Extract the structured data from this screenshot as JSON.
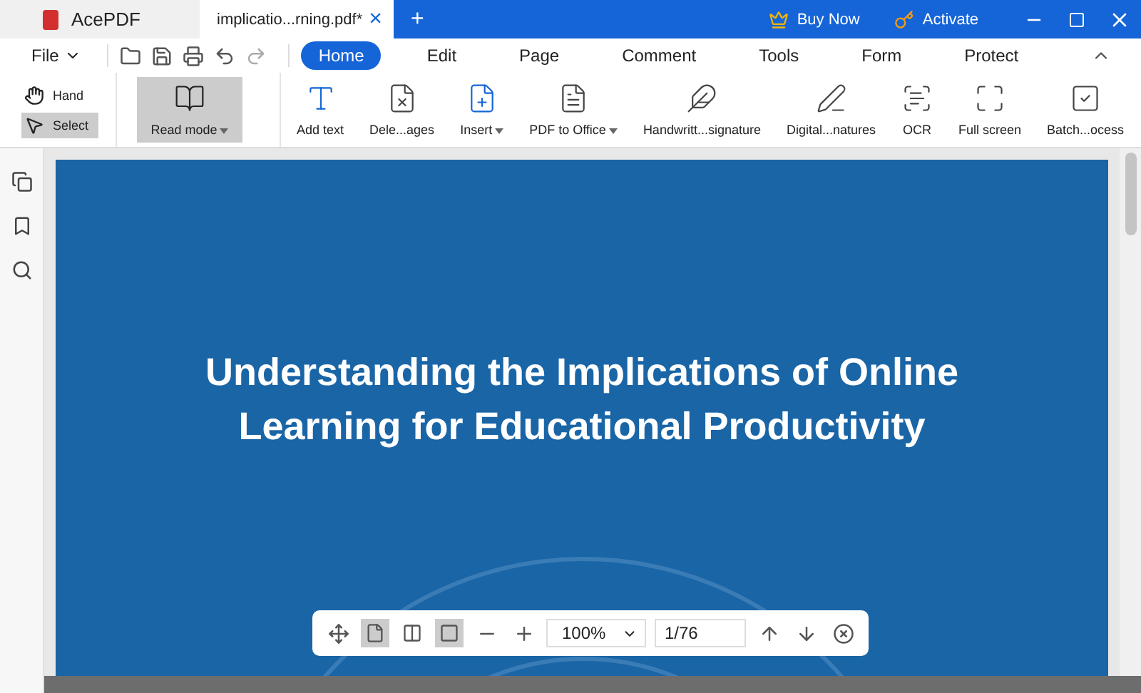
{
  "app": {
    "name": "AcePDF"
  },
  "doc_tab": {
    "title": "implicatio...rning.pdf*",
    "close": "×"
  },
  "new_tab": "+",
  "title_actions": [
    {
      "kind": "buy",
      "label": "Buy Now"
    },
    {
      "kind": "activate",
      "label": "Activate"
    }
  ],
  "file_menu": "File",
  "menu_tabs": [
    {
      "label": "Home",
      "selected": true
    },
    {
      "label": "Edit",
      "selected": false
    },
    {
      "label": "Page",
      "selected": false
    },
    {
      "label": "Comment",
      "selected": false
    },
    {
      "label": "Tools",
      "selected": false
    },
    {
      "label": "Form",
      "selected": false
    },
    {
      "label": "Protect",
      "selected": false
    }
  ],
  "pointer_tools": [
    {
      "kind": "hand",
      "label": "Hand",
      "selected": false
    },
    {
      "kind": "select",
      "label": "Select",
      "selected": true
    }
  ],
  "read_mode": {
    "label": "Read mode",
    "selected": true
  },
  "ribbon": [
    {
      "kind": "addtext",
      "label": "Add text",
      "dropdown": false
    },
    {
      "kind": "delete",
      "label": "Dele...ages",
      "dropdown": false
    },
    {
      "kind": "insert",
      "label": "Insert",
      "dropdown": true
    },
    {
      "kind": "office",
      "label": "PDF to Office",
      "dropdown": true
    },
    {
      "kind": "handwrite",
      "label": "Handwritt...signature",
      "dropdown": false
    },
    {
      "kind": "digital",
      "label": "Digital...natures",
      "dropdown": false
    },
    {
      "kind": "ocr",
      "label": "OCR",
      "dropdown": false
    },
    {
      "kind": "fullscreen",
      "label": "Full screen",
      "dropdown": false
    },
    {
      "kind": "batch",
      "label": "Batch...ocess",
      "dropdown": false
    }
  ],
  "page": {
    "title_lines": [
      "Understanding the Implications of Online",
      "Learning for Educational Productivity"
    ]
  },
  "view_bar": {
    "layouts": [
      {
        "kind": "single",
        "selected": true
      },
      {
        "kind": "double",
        "selected": false
      },
      {
        "kind": "scroll",
        "selected": true
      }
    ],
    "zoom": "100%",
    "page": "1/76"
  }
}
